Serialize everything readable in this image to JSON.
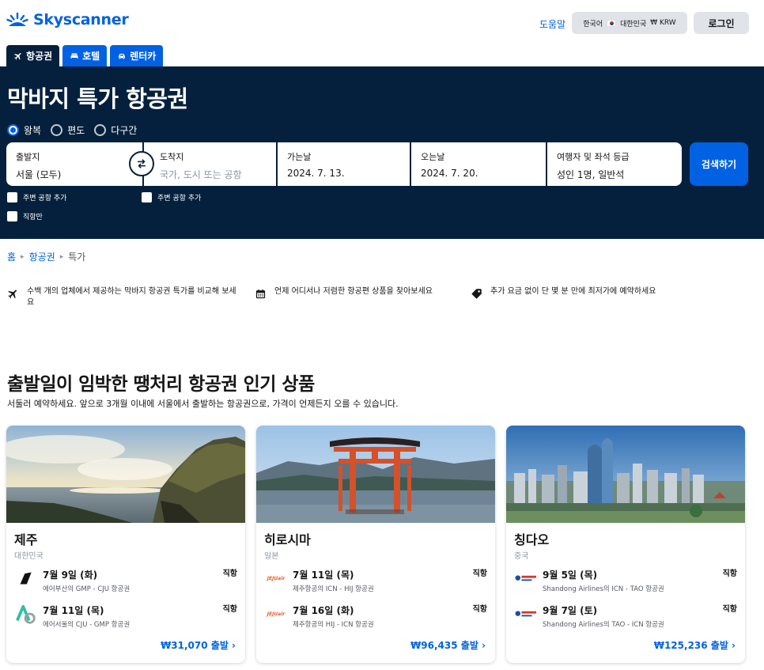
{
  "header": {
    "logo_text": "Skyscanner",
    "help": "도움말",
    "language": "한국어",
    "region": "대한민국",
    "currency": "₩ KRW",
    "login": "로그인"
  },
  "tabs": [
    {
      "label": "항공권",
      "icon": "plane-icon"
    },
    {
      "label": "호텔",
      "icon": "bed-icon"
    },
    {
      "label": "렌터카",
      "icon": "car-icon"
    }
  ],
  "hero": {
    "title": "막바지 특가 항공권",
    "trip_types": [
      "왕복",
      "편도",
      "다구간"
    ],
    "selected_trip_type": "왕복"
  },
  "search": {
    "from": {
      "label": "출발지",
      "value": "서울 (모두)"
    },
    "to": {
      "label": "도착지",
      "placeholder": "국가, 도시 또는 공항"
    },
    "depart": {
      "label": "가는날",
      "value": "2024. 7. 13."
    },
    "return": {
      "label": "오는날",
      "value": "2024. 7. 20."
    },
    "travellers": {
      "label": "여행자 및 좌석 등급",
      "value": "성인 1명, 일반석"
    },
    "button": "검색하기",
    "nearby_from": "주변 공항 추가",
    "nearby_to": "주변 공항 추가",
    "direct_only": "직항만"
  },
  "breadcrumb": {
    "home": "홈",
    "flights": "항공권",
    "current": "특가"
  },
  "features": [
    {
      "icon": "plane-icon",
      "text": "수백 개의 업체에서 제공하는 막바지 항공권 특가를 비교해 보세요"
    },
    {
      "icon": "calendar-icon",
      "text": "언제 어디서나 저렴한 항공편 상품을 찾아보세요"
    },
    {
      "icon": "tag-icon",
      "text": "추가 요금 없이 단 몇 분 만에 최저가에 예약하세요"
    }
  ],
  "section": {
    "title": "출발일이 임박한 땡처리 항공권 인기 상품",
    "subtitle": "서둘러 예약하세요. 앞으로 3개월 이내에 서울에서 출발하는 항공권으로, 가격이 언제든지 오를 수 있습니다."
  },
  "deals": [
    {
      "city": "제주",
      "country": "대한민국",
      "flights": [
        {
          "date": "7월 9일 (화)",
          "route": "에어부산의 GMP - CJU 항공권",
          "type": "직항",
          "airline": "air-busan-logo"
        },
        {
          "date": "7월 11일 (목)",
          "route": "에어서울의 CJU - GMP 항공권",
          "type": "직항",
          "airline": "air-seoul-logo"
        }
      ],
      "price": "₩31,070 출발 ›"
    },
    {
      "city": "히로시마",
      "country": "일본",
      "flights": [
        {
          "date": "7월 11일 (목)",
          "route": "제주항공의 ICN - HIJ 항공권",
          "type": "직항",
          "airline": "jeju-air-logo"
        },
        {
          "date": "7월 16일 (화)",
          "route": "제주항공의 HIJ - ICN 항공권",
          "type": "직항",
          "airline": "jeju-air-logo"
        }
      ],
      "price": "₩96,435 출발 ›"
    },
    {
      "city": "칭다오",
      "country": "중국",
      "flights": [
        {
          "date": "9월 5일 (목)",
          "route": "Shandong Airlines의 ICN - TAO 항공권",
          "type": "직항",
          "airline": "shandong-airlines-logo"
        },
        {
          "date": "9월 7일 (토)",
          "route": "Shandong Airlines의 TAO - ICN 항공권",
          "type": "직항",
          "airline": "shandong-airlines-logo"
        }
      ],
      "price": "₩125,236 출발 ›"
    }
  ],
  "jeju_air_text": "JEJUair",
  "colors": {
    "brand": "#0062e3",
    "hero_bg": "#05203c"
  }
}
